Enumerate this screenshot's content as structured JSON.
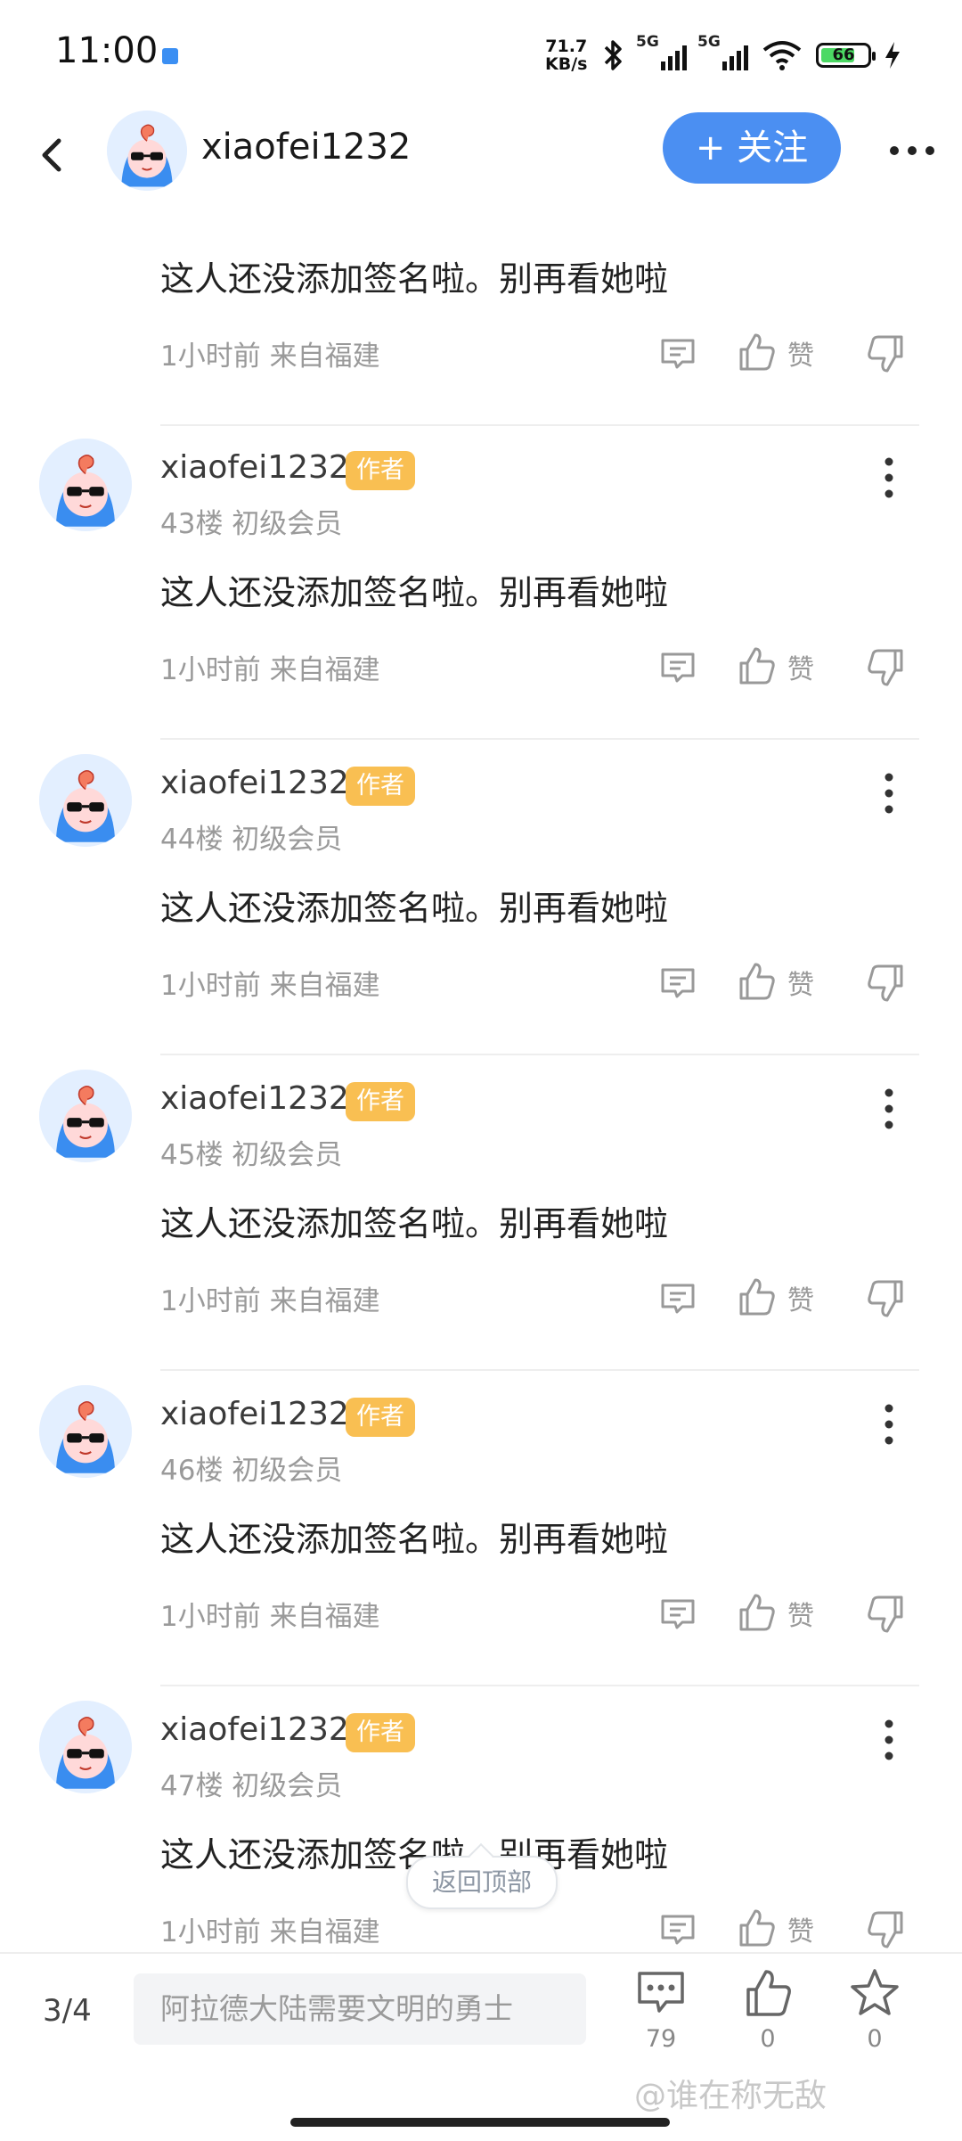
{
  "status_bar": {
    "time": "11:00",
    "net_speed_value": "71.7",
    "net_speed_unit": "KB/s",
    "signal1": "5G",
    "signal2": "5G",
    "battery": "66",
    "icons": [
      "app-notification-icon",
      "bluetooth-icon",
      "signal-icon",
      "signal-icon",
      "wifi-icon",
      "battery-icon",
      "charging-icon"
    ]
  },
  "header": {
    "username": "xiaofei1232",
    "follow_label": "+ 关注",
    "icons": [
      "back-arrow-icon",
      "more-icon"
    ]
  },
  "posts": [
    {
      "content": "这人还没添加签名啦。别再看她啦",
      "time_loc": "1小时前 来自福建",
      "like_label": "赞"
    },
    {
      "username": "xiaofei1232",
      "badge": "作者",
      "floor": "43楼 初级会员",
      "content": "这人还没添加签名啦。别再看她啦",
      "time_loc": "1小时前 来自福建",
      "like_label": "赞"
    },
    {
      "username": "xiaofei1232",
      "badge": "作者",
      "floor": "44楼 初级会员",
      "content": "这人还没添加签名啦。别再看她啦",
      "time_loc": "1小时前 来自福建",
      "like_label": "赞"
    },
    {
      "username": "xiaofei1232",
      "badge": "作者",
      "floor": "45楼 初级会员",
      "content": "这人还没添加签名啦。别再看她啦",
      "time_loc": "1小时前 来自福建",
      "like_label": "赞"
    },
    {
      "username": "xiaofei1232",
      "badge": "作者",
      "floor": "46楼 初级会员",
      "content": "这人还没添加签名啦。别再看她啦",
      "time_loc": "1小时前 来自福建",
      "like_label": "赞"
    },
    {
      "username": "xiaofei1232",
      "badge": "作者",
      "floor": "47楼 初级会员",
      "content": "这人还没添加签名啦。别再看她啦",
      "time_loc": "1小时前 来自福建",
      "like_label": "赞"
    }
  ],
  "back_to_top_label": "返回顶部",
  "bottom_bar": {
    "page": "3/4",
    "comment_placeholder": "阿拉德大陆需要文明的勇士",
    "comments_count": "79",
    "likes_count": "0",
    "favorites_count": "0"
  },
  "watermark": "@谁在称无敌",
  "colors": {
    "accent": "#4b8ff2",
    "badge": "#f9bf52",
    "muted_text": "#9a9a9a",
    "avatar_bg": "#e3efff"
  }
}
